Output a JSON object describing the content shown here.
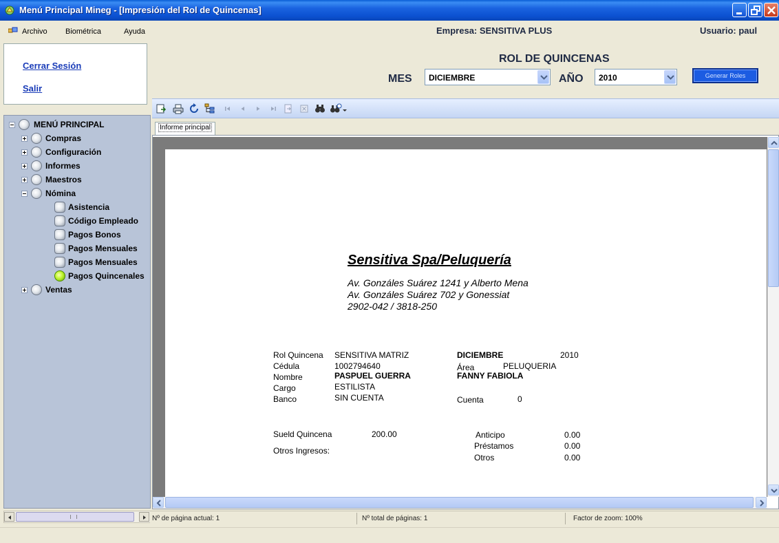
{
  "window": {
    "title": "Menú Principal Mineg - [Impresión del Rol de Quincenas]"
  },
  "menubar": {
    "items": [
      "Archivo",
      "Biométrica",
      "Ayuda"
    ],
    "empresa": "Empresa: SENSITIVA PLUS",
    "usuario": "Usuario: paul"
  },
  "session": {
    "logout": "Cerrar Sesión",
    "exit": "Salir"
  },
  "tree": {
    "root": "MENÚ PRINCIPAL",
    "items": [
      "Compras",
      "Configuración",
      "Informes",
      "Maestros",
      "Nómina",
      "Ventas"
    ],
    "nomina_children": [
      "Asistencia",
      "Código Empleado",
      "Pagos Bonos",
      "Pagos Mensuales",
      "Pagos Mensuales",
      "Pagos Quincenales"
    ],
    "active": "Pagos Quincenales"
  },
  "header": {
    "title": "ROL DE QUINCENAS",
    "mes_label": "MES",
    "mes_value": "DICIEMBRE",
    "anio_label": "AÑO",
    "anio_value": "2010",
    "generate_button": "Generar Roles"
  },
  "viewer": {
    "tab": "Informe principal",
    "status": {
      "current_page": "Nº de página actual: 1",
      "total_pages": "Nº total de páginas: 1",
      "zoom": "Factor de zoom: 100%"
    }
  },
  "report": {
    "company": "Sensitiva Spa/Peluquería",
    "address1": "Av. Gonzáles Suárez 1241 y Alberto Mena",
    "address2": "Av. Gonzáles Suárez 702 y Gonessiat",
    "phones": "2902-042 / 3818-250",
    "rol_label": "Rol Quincena",
    "rol_value": "SENSITIVA MATRIZ",
    "month": "DICIEMBRE",
    "year": "2010",
    "cedula_label": "Cédula",
    "cedula_value": "1002794640",
    "area_label": "Área",
    "area_value": "PELUQUERIA",
    "nombre_label": "Nombre",
    "apellidos": "PASPUEL GUERRA",
    "nombres": "FANNY FABIOLA",
    "cargo_label": "Cargo",
    "cargo_value": "ESTILISTA",
    "banco_label": "Banco",
    "banco_value": "SIN CUENTA",
    "cuenta_label": "Cuenta",
    "cuenta_value": "0",
    "sueldo_label": "Sueld Quincena",
    "sueldo_value": "200.00",
    "otros_ingresos_label": "Otros Ingresos:",
    "anticipo_label": "Anticipo",
    "anticipo_value": "0.00",
    "prestamos_label": "Préstamos",
    "prestamos_value": "0.00",
    "otros_label": "Otros",
    "otros_value": "0.00"
  },
  "colors": {
    "titlebar": "#0b50d0",
    "tree_bg": "#b8c4d8",
    "link": "#1a3cb8",
    "active_node": "#bff52e"
  }
}
